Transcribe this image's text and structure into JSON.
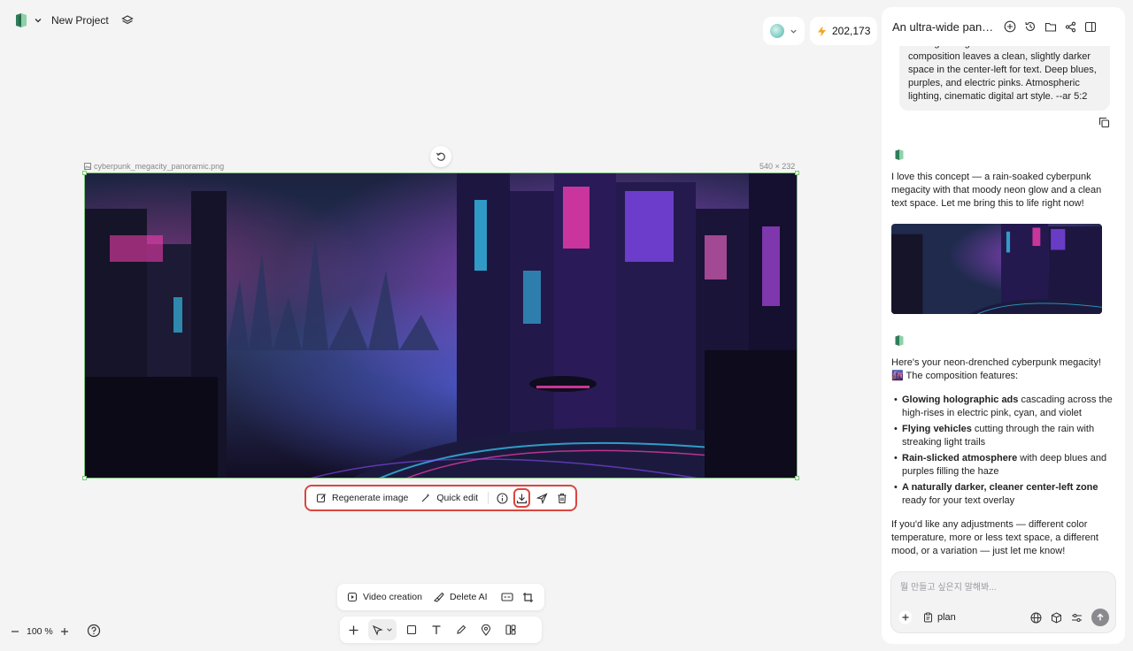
{
  "project": {
    "name": "New Project"
  },
  "credits": {
    "amount": "202,173"
  },
  "canvas": {
    "image_filename": "cyberpunk_megacity_panoramic.png",
    "image_size": "540 × 232"
  },
  "image_actions": {
    "regenerate_label": "Regenerate image",
    "quick_edit_label": "Quick edit"
  },
  "video_bar": {
    "video_creation_label": "Video creation",
    "delete_ai_label": "Delete AI"
  },
  "zoom": {
    "level": "100 %"
  },
  "panel": {
    "title": "An ultra-wide panor...",
    "prompt_text": "moving through rain-slicked streets. The composition leaves a clean, slightly darker space in the center-left for text. Deep blues, purples, and electric pinks. Atmospheric lighting, cinematic digital art style. --ar 5:2",
    "reply1": "I love this concept — a rain-soaked cyberpunk megacity with that moody neon glow and a clean text space. Let me bring this to life right now!",
    "reply2_intro": "Here's your neon-drenched cyberpunk megacity! 🌆 The composition features:",
    "features": [
      {
        "bold": "Glowing holographic ads",
        "rest": " cascading across the high-rises in electric pink, cyan, and violet"
      },
      {
        "bold": "Flying vehicles",
        "rest": " cutting through the rain with streaking light trails"
      },
      {
        "bold": "Rain-slicked atmosphere",
        "rest": " with deep blues and purples filling the haze"
      },
      {
        "bold": "A naturally darker, cleaner center-left zone",
        "rest": " ready for your text overlay"
      }
    ],
    "closing": "If you'd like any adjustments — different color temperature, more or less text space, a different mood, or a variation — just let me know!",
    "input_placeholder": "뭘 만들고 싶은지 말해봐...",
    "plan_label": "plan"
  },
  "colors": {
    "highlight": "#d9463f",
    "selection": "#7cc47a",
    "neon_pink": "#ff3fb4",
    "neon_cyan": "#39d3ff",
    "neon_violet": "#8a4dff"
  }
}
